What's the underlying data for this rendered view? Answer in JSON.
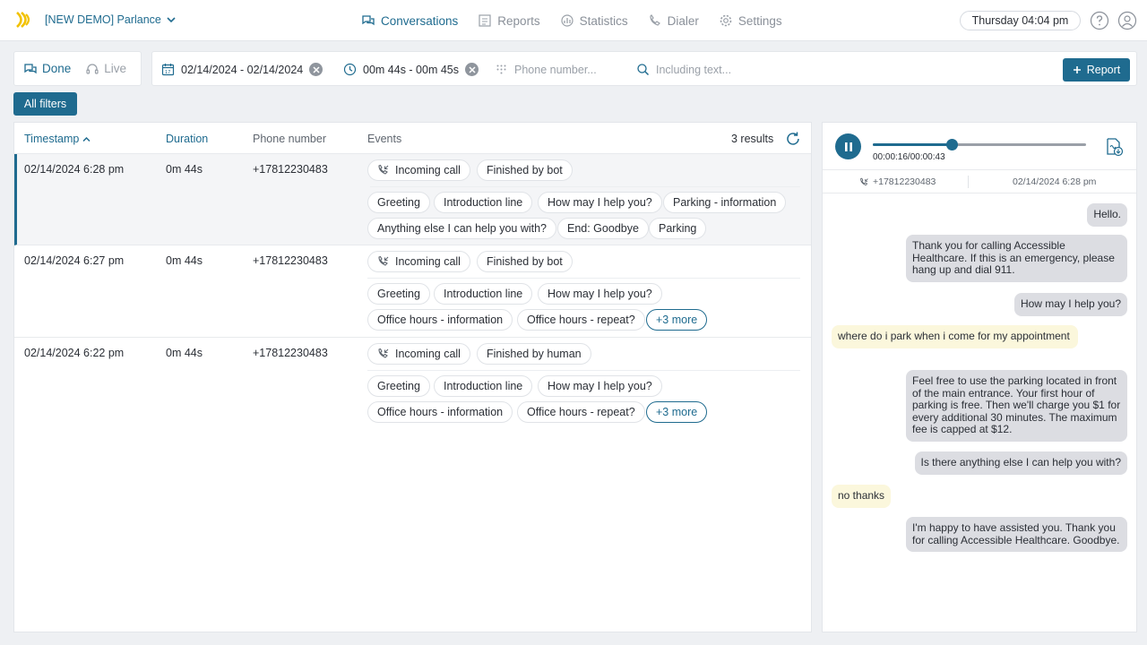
{
  "header": {
    "workspace": "[NEW DEMO] Parlance",
    "nav": [
      {
        "label": "Conversations",
        "icon": "conversations-icon",
        "active": true
      },
      {
        "label": "Reports",
        "icon": "reports-icon",
        "active": false
      },
      {
        "label": "Statistics",
        "icon": "statistics-icon",
        "active": false
      },
      {
        "label": "Dialer",
        "icon": "dialer-icon",
        "active": false
      },
      {
        "label": "Settings",
        "icon": "gear-icon",
        "active": false
      }
    ],
    "datetime": "Thursday 04:04 pm"
  },
  "modes": {
    "done": "Done",
    "live": "Live"
  },
  "filters": {
    "date_range": "02/14/2024 - 02/14/2024",
    "duration_range": "00m 44s - 00m 45s",
    "phone_placeholder": "Phone number...",
    "text_placeholder": "Including text...",
    "report_button": "Report",
    "all_filters_button": "All filters"
  },
  "table": {
    "columns": {
      "timestamp": "Timestamp",
      "duration": "Duration",
      "phone": "Phone number",
      "events": "Events"
    },
    "results_count": "3 results",
    "rows": [
      {
        "timestamp": "02/14/2024 6:28 pm",
        "duration": "0m 44s",
        "phone": "+17812230483",
        "status": [
          "Incoming call",
          "Finished by bot"
        ],
        "events_line1": [
          "Greeting",
          "Introduction line",
          "How may I help you?",
          "Parking - information"
        ],
        "events_line2": [
          "Anything else I can help you with?",
          "End: Goodbye",
          "Parking"
        ]
      },
      {
        "timestamp": "02/14/2024 6:27 pm",
        "duration": "0m 44s",
        "phone": "+17812230483",
        "status": [
          "Incoming call",
          "Finished by bot"
        ],
        "events_line1": [
          "Greeting",
          "Introduction line",
          "How may I help you?"
        ],
        "events_line2": [
          "Office hours - information",
          "Office hours - repeat?"
        ],
        "more": "+3 more"
      },
      {
        "timestamp": "02/14/2024 6:22 pm",
        "duration": "0m 44s",
        "phone": "+17812230483",
        "status": [
          "Incoming call",
          "Finished by human"
        ],
        "events_line1": [
          "Greeting",
          "Introduction line",
          "How may I help you?"
        ],
        "events_line2": [
          "Office hours - information",
          "Office hours - repeat?"
        ],
        "more": "+3 more"
      }
    ]
  },
  "player": {
    "time": "00:00:16/00:00:43",
    "progress": 0.37,
    "phone": "+17812230483",
    "timestamp": "02/14/2024 6:28 pm"
  },
  "transcript": [
    {
      "speaker": "bot",
      "text": "Hello."
    },
    {
      "speaker": "bot",
      "text": "Thank you for calling Accessible Healthcare. If this is an emergency, please hang up and dial 911."
    },
    {
      "speaker": "bot",
      "text": "How may I help you?"
    },
    {
      "speaker": "user",
      "text": "where do i park when i come for my appointment"
    },
    {
      "speaker": "bot",
      "text": "Feel free to use the parking located in front of the main entrance. Your first hour of parking is free. Then we'll charge you $1 for every additional 30 minutes. The maximum fee is capped at $12."
    },
    {
      "speaker": "bot",
      "text": "Is there anything else I can help you with?"
    },
    {
      "speaker": "user",
      "text": "no thanks"
    },
    {
      "speaker": "bot",
      "text": "I'm happy to have assisted you. Thank you for calling Accessible Healthcare. Goodbye."
    }
  ],
  "colors": {
    "accent": "#1f6b8f",
    "bot_bubble": "#dcdde2",
    "user_bubble": "#fbf7dc"
  }
}
